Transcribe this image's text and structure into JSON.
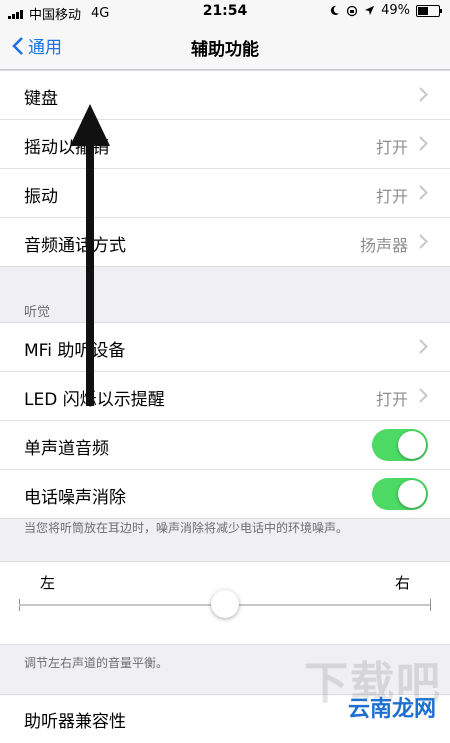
{
  "status": {
    "carrier": "中国移动",
    "network": "4G",
    "time": "21:54",
    "battery": "49%",
    "battery_level": 0.49,
    "icons": [
      "moon-icon",
      "lock-rotation-icon",
      "location-icon",
      "battery-icon"
    ]
  },
  "nav": {
    "back_label": "通用",
    "title": "辅助功能"
  },
  "group1": [
    {
      "label": "键盘",
      "value": ""
    },
    {
      "label": "摇动以撤销",
      "value": "打开"
    },
    {
      "label": "振动",
      "value": "打开"
    },
    {
      "label": "音频通话方式",
      "value": "扬声器"
    }
  ],
  "hearing": {
    "header": "听觉",
    "rows": [
      {
        "label": "MFi 助听设备",
        "value": ""
      },
      {
        "label": "LED 闪烁以示提醒",
        "value": "打开"
      },
      {
        "label": "单声道音频",
        "toggle": true
      },
      {
        "label": "电话噪声消除",
        "toggle": true
      }
    ],
    "footer": "当您将听筒放在耳边时，噪声消除将减少电话中的环境噪声。"
  },
  "balance": {
    "left_label": "左",
    "right_label": "右",
    "value": 0.5,
    "footer": "调节左右声道的音量平衡。"
  },
  "group3": [
    {
      "label": "助听器兼容性"
    }
  ],
  "watermark": "云南龙网",
  "colors": {
    "accent": "#1a73e8",
    "toggle_on": "#4cd964",
    "background": "#efeff4",
    "arrow": "#111111"
  }
}
